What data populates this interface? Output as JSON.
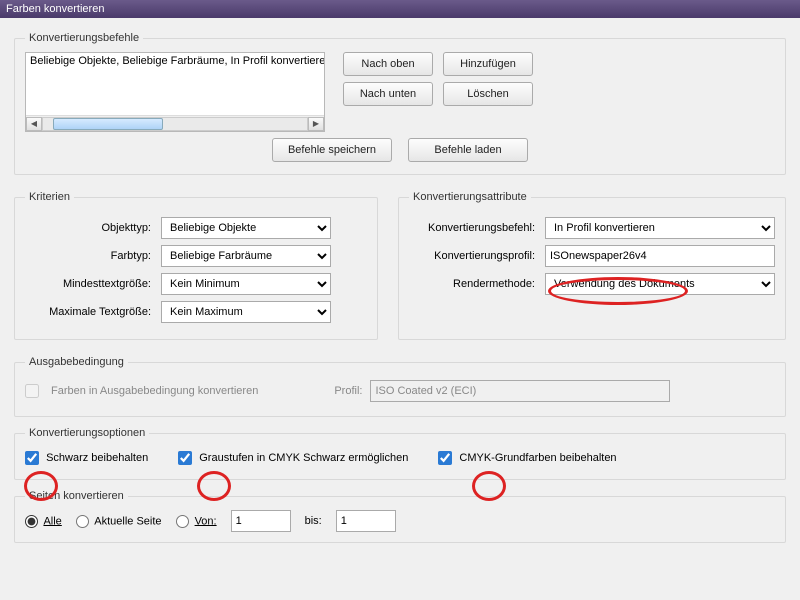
{
  "window": {
    "title": "Farben konvertieren"
  },
  "commands_group": {
    "legend": "Konvertierungsbefehle",
    "list_item": "Beliebige Objekte, Beliebige Farbräume, In Profil konvertieren",
    "move_up": "Nach oben",
    "add": "Hinzufügen",
    "move_down": "Nach unten",
    "delete": "Löschen",
    "save_cmds": "Befehle speichern",
    "load_cmds": "Befehle laden"
  },
  "criteria": {
    "legend": "Kriterien",
    "object_type_label": "Objekttyp:",
    "object_type_value": "Beliebige Objekte",
    "color_type_label": "Farbtyp:",
    "color_type_value": "Beliebige Farbräume",
    "min_text_label": "Mindesttextgröße:",
    "min_text_value": "Kein Minimum",
    "max_text_label": "Maximale Textgröße:",
    "max_text_value": "Kein Maximum"
  },
  "attributes": {
    "legend": "Konvertierungsattribute",
    "command_label": "Konvertierungsbefehl:",
    "command_value": "In Profil konvertieren",
    "profile_label": "Konvertierungsprofil:",
    "profile_value": "ISOnewspaper26v4",
    "render_label": "Rendermethode:",
    "render_value": "Verwendung des Dokuments"
  },
  "output": {
    "legend": "Ausgabebedingung",
    "checkbox_label": "Farben in Ausgabebedingung konvertieren",
    "profile_label": "Profil:",
    "profile_value": "ISO Coated v2 (ECI)"
  },
  "options": {
    "legend": "Konvertierungsoptionen",
    "preserve_black": "Schwarz beibehalten",
    "gray_to_k": "Graustufen in CMYK Schwarz ermöglichen",
    "preserve_primaries": "CMYK-Grundfarben beibehalten"
  },
  "pages": {
    "legend": "Seiten konvertieren",
    "all": "Alle",
    "current": "Aktuelle Seite",
    "from_label": "Von:",
    "from_value": "1",
    "to_label": "bis:",
    "to_value": "1"
  }
}
